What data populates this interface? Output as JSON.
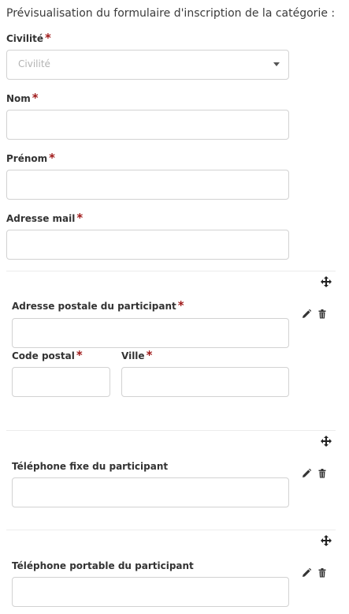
{
  "heading": "Prévisualisation du formulaire d'inscription de la catégorie :",
  "required_marker": "*",
  "civilite": {
    "label": "Civilité",
    "placeholder": "Civilité"
  },
  "nom": {
    "label": "Nom"
  },
  "prenom": {
    "label": "Prénom"
  },
  "email": {
    "label": "Adresse mail"
  },
  "adresse_section": {
    "label": "Adresse postale du participant",
    "code_postal": "Code postal",
    "ville": "Ville"
  },
  "tel_fixe_section": {
    "label": "Téléphone fixe du participant"
  },
  "tel_portable_section": {
    "label": "Téléphone portable du participant"
  },
  "icons": {
    "move": "move-icon",
    "edit": "pencil-icon",
    "delete": "trash-icon"
  }
}
